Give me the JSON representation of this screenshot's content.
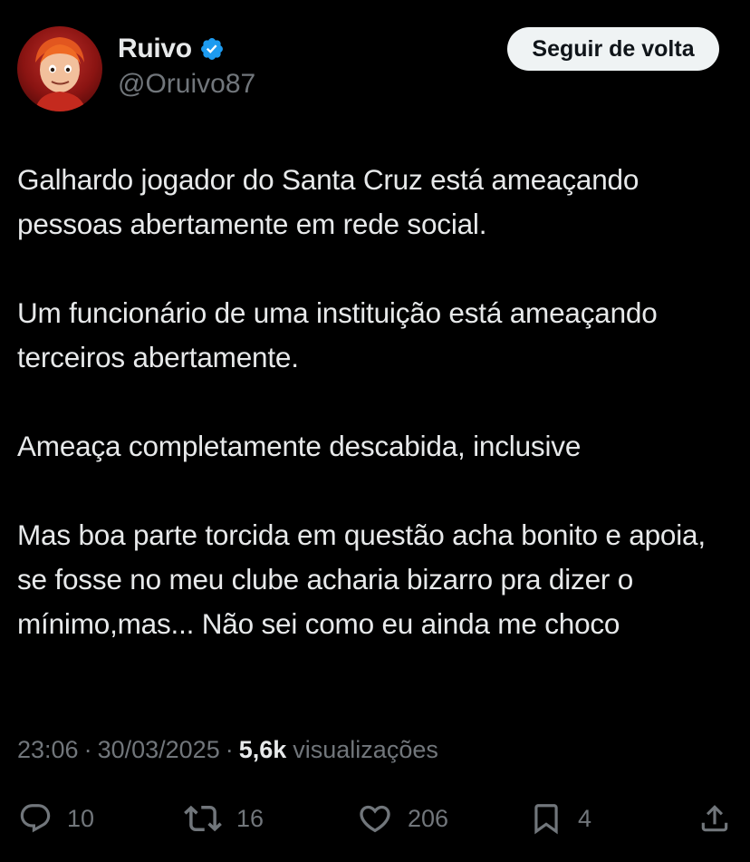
{
  "author": {
    "display_name": "Ruivo",
    "handle": "@Oruivo87",
    "verified": true,
    "verified_color": "#1d9bf0"
  },
  "follow_button": {
    "label": "Seguir de volta"
  },
  "tweet": {
    "paragraphs": [
      "Galhardo jogador do Santa Cruz está ameaçando pessoas abertamente em rede social.",
      "Um funcionário de uma instituição está ameaçando terceiros abertamente.",
      "Ameaça completamente descabida, inclusive",
      "Mas boa parte torcida em questão acha bonito e apoia, se fosse no meu clube acharia bizarro pra dizer o mínimo,mas... Não sei como eu ainda me choco"
    ]
  },
  "meta": {
    "time": "23:06",
    "date": "30/03/2025",
    "separator": "·",
    "views_count": "5,6k",
    "views_label": "visualizações"
  },
  "actions": {
    "replies": "10",
    "retweets": "16",
    "likes": "206",
    "bookmarks": "4"
  },
  "icons": {
    "reply": "reply-bubble-icon",
    "retweet": "retweet-icon",
    "like": "heart-icon",
    "bookmark": "bookmark-icon",
    "share": "share-upload-icon",
    "verified": "verified-badge-icon"
  },
  "colors": {
    "background": "#000000",
    "text_primary": "#e7e9ea",
    "text_secondary": "#71767b",
    "button_bg": "#eff3f4",
    "button_text": "#0f1419"
  }
}
